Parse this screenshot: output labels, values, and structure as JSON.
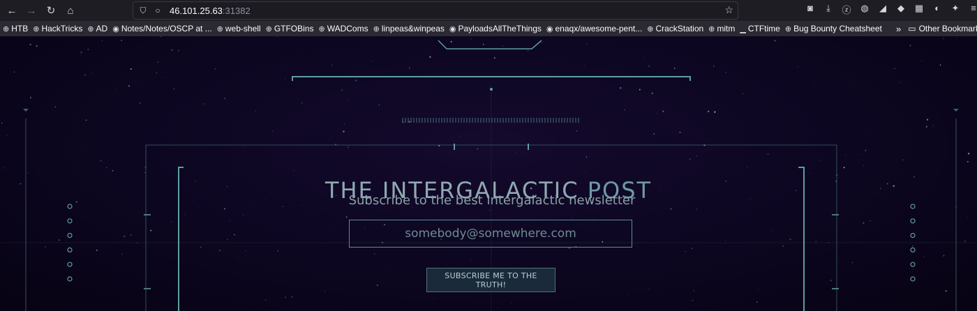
{
  "browser": {
    "url_host": "46.101.25.63",
    "url_port": ":31382",
    "bookmarks": [
      {
        "label": "HTB",
        "icon": "globe-icon"
      },
      {
        "label": "HackTricks",
        "icon": "globe-icon"
      },
      {
        "label": "AD",
        "icon": "globe-icon"
      },
      {
        "label": "Notes/Notes/OSCP at ...",
        "icon": "github-icon"
      },
      {
        "label": "web-shell",
        "icon": "globe-icon"
      },
      {
        "label": "GTFOBins",
        "icon": "globe-icon"
      },
      {
        "label": "WADComs",
        "icon": "globe-icon"
      },
      {
        "label": "linpeas&winpeas",
        "icon": "globe-icon"
      },
      {
        "label": "PayloadsAllTheThings",
        "icon": "github-icon"
      },
      {
        "label": "enaqx/awesome-pent...",
        "icon": "github-icon"
      },
      {
        "label": "CrackStation",
        "icon": "globe-icon"
      },
      {
        "label": "mitm",
        "icon": "globe-icon"
      },
      {
        "label": "CTFtime",
        "icon": "ctftime-icon"
      },
      {
        "label": "Bug Bounty Cheatsheet",
        "icon": "globe-icon"
      }
    ],
    "other_bookmarks": "Other Bookmarks",
    "overflow_chevron": "»"
  },
  "page": {
    "title_main": "THE INTERGALACTIC ",
    "title_accent": "POST",
    "subtitle": "Subscribe to the best intergalactic newsletter",
    "email_placeholder": "somebody@somewhere.com",
    "subscribe_label": "SUBSCRIBE ME TO THE TRUTH!"
  },
  "colors": {
    "background": "#0b0519",
    "hud_line": "#5f9ea0",
    "text": "#8fa9b0"
  }
}
